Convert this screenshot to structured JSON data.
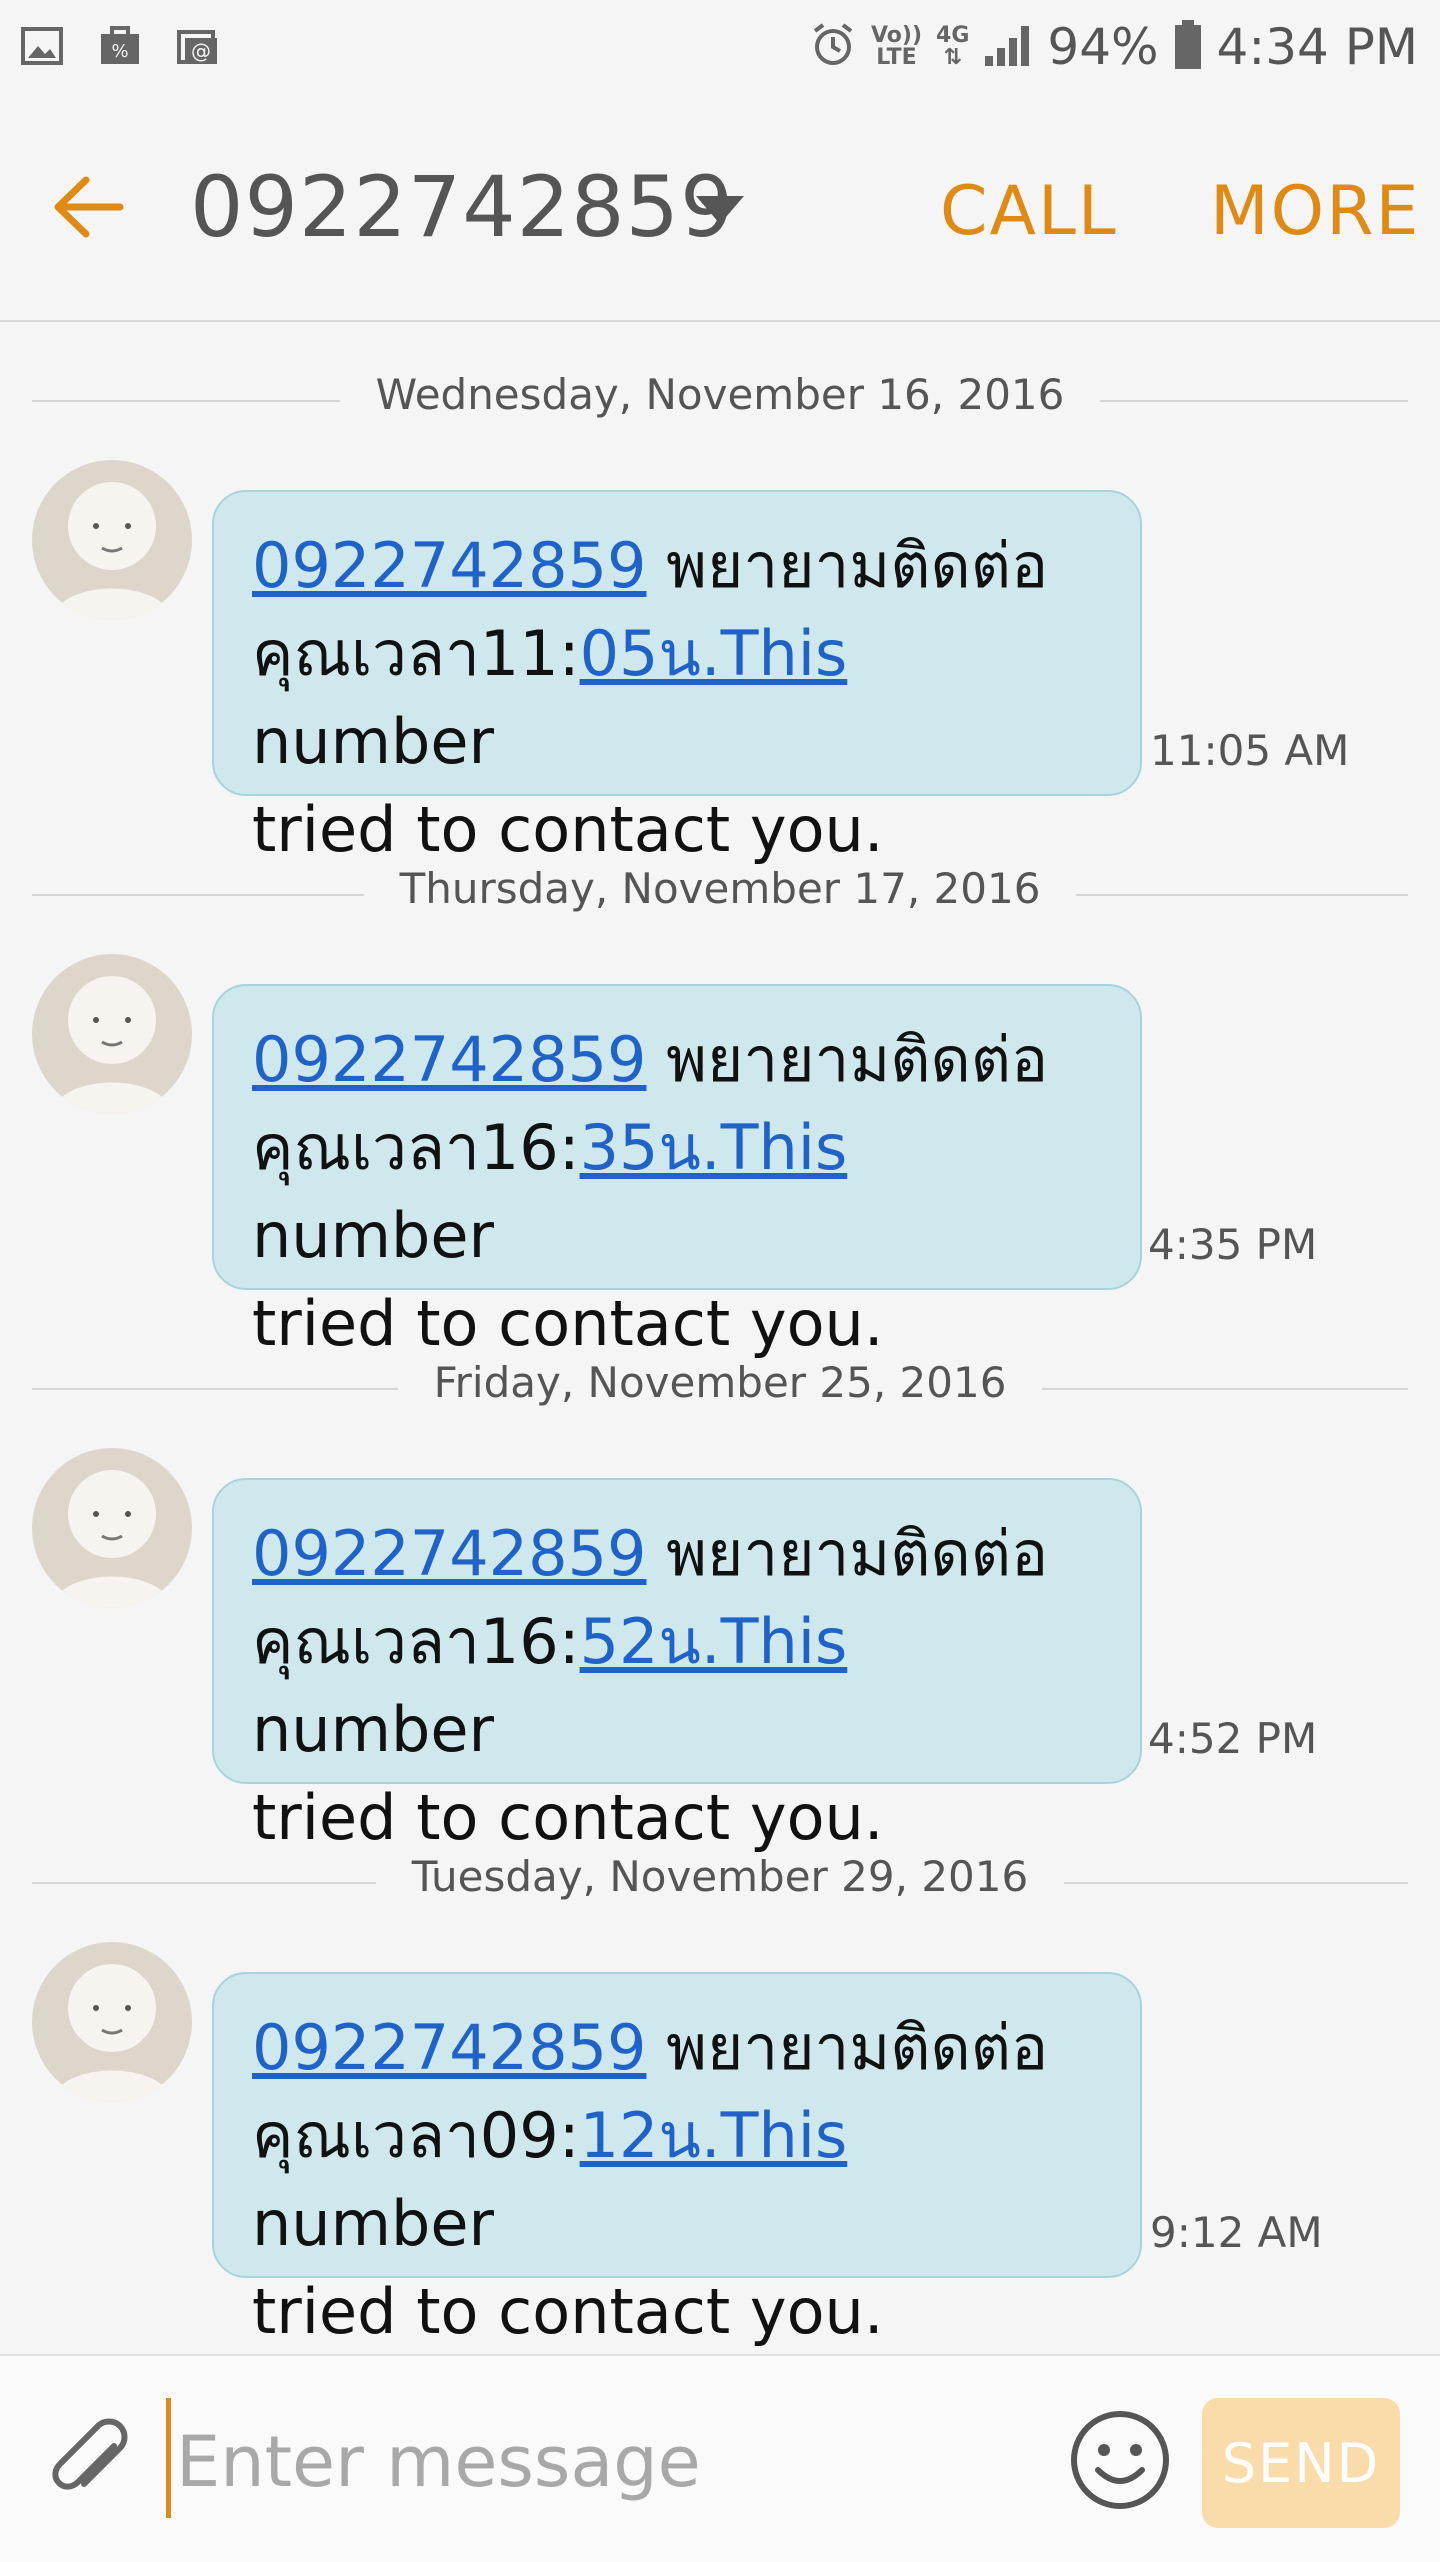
{
  "status_bar": {
    "volte_top": "Vo))",
    "volte_bottom": "LTE",
    "network": "4G",
    "battery": "94%",
    "time": "4:34 PM"
  },
  "header": {
    "title": "0922742859",
    "call_label": "CALL",
    "more_label": "MORE"
  },
  "messages": [
    {
      "date": "Wednesday, November 16, 2016",
      "link1": "0922742859",
      "text1": " พยายามติดต่อ",
      "text2": "คุณเวลา11:",
      "link2": "05น.This",
      "text3": " number",
      "text4": "tried to contact you.",
      "time": "11:05 AM"
    },
    {
      "date": "Thursday, November 17, 2016",
      "link1": "0922742859",
      "text1": " พยายามติดต่อ",
      "text2": "คุณเวลา16:",
      "link2": "35น.This",
      "text3": " number",
      "text4": "tried to contact you.",
      "time": "4:35 PM"
    },
    {
      "date": "Friday, November 25, 2016",
      "link1": "0922742859",
      "text1": " พยายามติดต่อ",
      "text2": "คุณเวลา16:",
      "link2": "52น.This",
      "text3": " number",
      "text4": "tried to contact you.",
      "time": "4:52 PM"
    },
    {
      "date": "Tuesday, November 29, 2016",
      "link1": "0922742859",
      "text1": " พยายามติดต่อ",
      "text2": "คุณเวลา09:",
      "link2": "12น.This",
      "text3": " number",
      "text4": "tried to contact you.",
      "time": "9:12 AM"
    }
  ],
  "composer": {
    "placeholder": "Enter message",
    "send_label": "SEND"
  },
  "colors": {
    "accent": "#e08a14",
    "bubble": "#cfe8ee",
    "link": "#1f63c8"
  }
}
